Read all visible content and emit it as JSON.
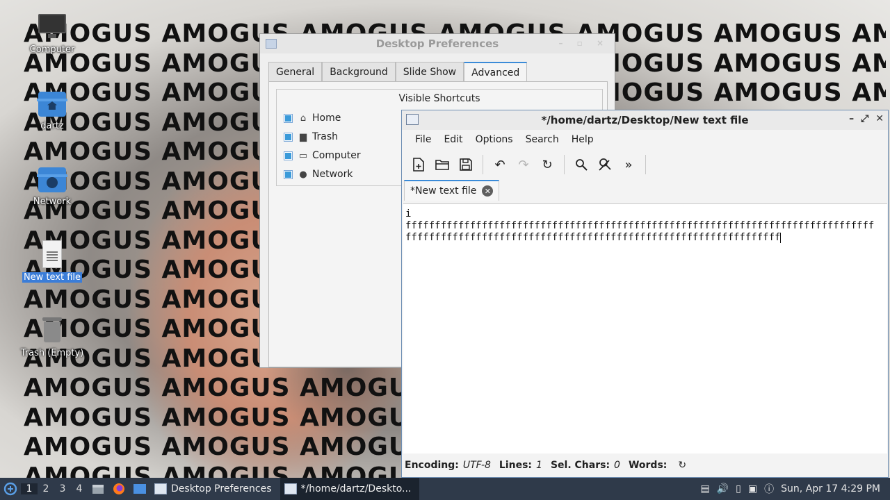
{
  "wallpaper": {
    "word": "AMOGUS",
    "rows": 16,
    "cols": 8
  },
  "desktop_icons": [
    {
      "id": "computer",
      "label": "Computer",
      "icon": "computer-icon",
      "selected": false
    },
    {
      "id": "home",
      "label": "dartz",
      "icon": "home-folder-icon",
      "selected": false
    },
    {
      "id": "network",
      "label": "Network",
      "icon": "network-folder-icon",
      "selected": false
    },
    {
      "id": "file",
      "label": "New text file",
      "icon": "text-file-icon",
      "selected": true
    },
    {
      "id": "trash",
      "label": "Trash (Empty)",
      "icon": "trash-icon",
      "selected": false
    }
  ],
  "prefs": {
    "title": "Desktop Preferences",
    "tabs": [
      "General",
      "Background",
      "Slide Show",
      "Advanced"
    ],
    "active_tab": "Advanced",
    "group_title": "Visible Shortcuts",
    "shortcuts": [
      {
        "label": "Home",
        "icon": "home-icon",
        "checked": true
      },
      {
        "label": "Trash",
        "icon": "trash-icon",
        "checked": true
      },
      {
        "label": "Computer",
        "icon": "monitor-icon",
        "checked": true
      },
      {
        "label": "Network",
        "icon": "globe-icon",
        "checked": true
      }
    ]
  },
  "editor": {
    "title": "*/home/dartz/Desktop/New text file",
    "menu": [
      "File",
      "Edit",
      "Options",
      "Search",
      "Help"
    ],
    "toolbar": [
      "new-file-icon",
      "open-folder-icon",
      "save-icon",
      "undo-icon",
      "redo-icon",
      "reload-icon",
      "find-icon",
      "replace-icon",
      "more-icon"
    ],
    "tab_label": "*New text file",
    "lines": [
      "i",
      "ffffffffffffffffffffffffffffffffffffffffffffffffffffffffffffffffffffffffffffffff",
      "ffffffffffffffffffffffffffffffffffffffffffffffffffffffffffffffff"
    ],
    "status": {
      "encoding_label": "Encoding:",
      "encoding": "UTF-8",
      "lines_label": "Lines:",
      "lines": "1",
      "sel_label": "Sel. Chars:",
      "sel": "0",
      "words_label": "Words:"
    }
  },
  "taskbar": {
    "workspaces": [
      "1",
      "2",
      "3",
      "4"
    ],
    "active_workspace": "1",
    "tasks": [
      {
        "label": "Desktop Preferences",
        "active": false
      },
      {
        "label": "*/home/dartz/Deskto...",
        "active": true
      }
    ],
    "clock": "Sun, Apr 17  4:29 PM"
  },
  "colors": {
    "accent": "#3b8bd8",
    "taskbar": "#2f3a4a",
    "selection": "#3b7dd8"
  }
}
